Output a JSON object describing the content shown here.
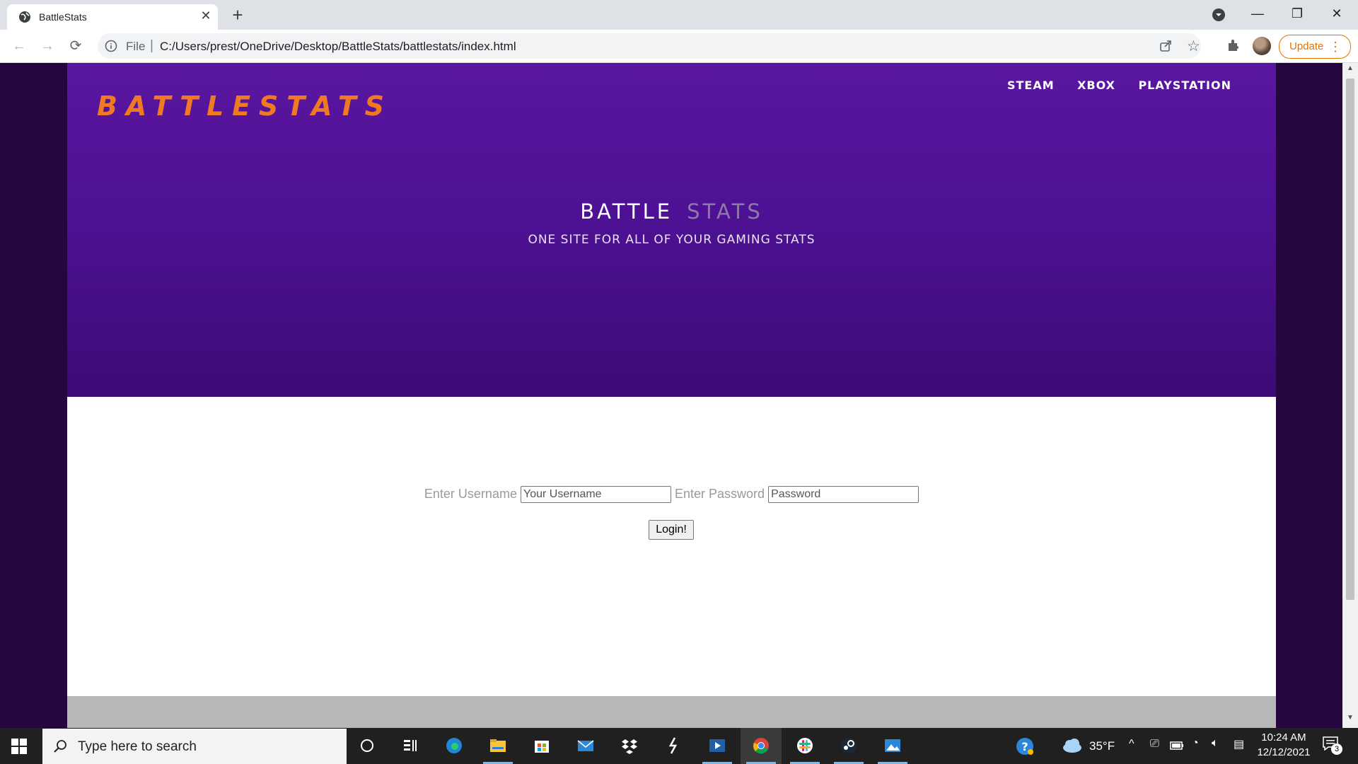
{
  "browser": {
    "tab_title": "BattleStats",
    "url_scheme": "File",
    "url": "C:/Users/prest/OneDrive/Desktop/BattleStats/battlestats/index.html",
    "update_label": "Update"
  },
  "page": {
    "logo_text": "BATTLESTATS",
    "nav": [
      "STEAM",
      "XBOX",
      "PLAYSTATION"
    ],
    "hero_title_1": "BATTLE",
    "hero_title_2": "STATS",
    "hero_subtitle": "ONE SITE FOR ALL OF YOUR GAMING STATS",
    "login": {
      "username_label": "Enter Username",
      "username_placeholder": "Your Username",
      "password_label": "Enter Password",
      "password_placeholder": "Password",
      "button_label": "Login!"
    }
  },
  "taskbar": {
    "search_placeholder": "Type here to search",
    "temperature": "35°F",
    "time": "10:24 AM",
    "date": "12/12/2021",
    "notification_count": "3"
  },
  "colors": {
    "hero_purple": "#5a169f",
    "logo_orange": "#f07a24",
    "page_side": "#260640",
    "footer_gray": "#b8b8b8"
  }
}
